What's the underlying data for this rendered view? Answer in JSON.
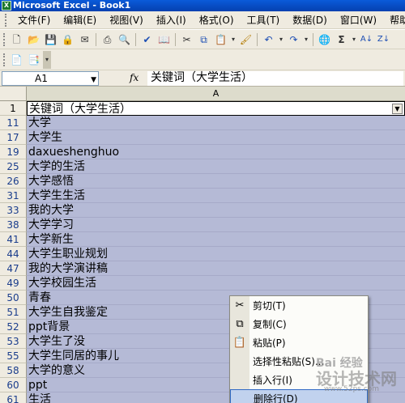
{
  "window": {
    "title": "Microsoft Excel - Book1"
  },
  "menu": [
    "文件(F)",
    "编辑(E)",
    "视图(V)",
    "插入(I)",
    "格式(O)",
    "工具(T)",
    "数据(D)",
    "窗口(W)",
    "帮助"
  ],
  "toolbar_icons": [
    "new-document-icon",
    "open-folder-icon",
    "save-icon",
    "permission-icon",
    "email-icon",
    "print-icon",
    "print-preview-icon",
    "spelling-icon",
    "research-icon",
    "cut-icon",
    "copy-icon",
    "paste-icon",
    "format-painter-icon",
    "undo-icon",
    "redo-icon",
    "hyperlink-icon",
    "autosum-icon",
    "sort-ascending-icon",
    "sort-descending-icon"
  ],
  "formula_bar": {
    "name_box": "A1",
    "fx": "fx",
    "value": "关键词（大学生活）"
  },
  "sheet": {
    "column_header": "A",
    "rows": [
      {
        "num": "1",
        "value": "关键词（大学生活）",
        "header": true
      },
      {
        "num": "11",
        "value": "大学"
      },
      {
        "num": "17",
        "value": "大学生"
      },
      {
        "num": "19",
        "value": "daxueshenghuo"
      },
      {
        "num": "25",
        "value": "大学的生活"
      },
      {
        "num": "26",
        "value": "大学感悟"
      },
      {
        "num": "31",
        "value": "大学生生活"
      },
      {
        "num": "33",
        "value": "我的大学"
      },
      {
        "num": "38",
        "value": "大学学习"
      },
      {
        "num": "41",
        "value": "大学新生"
      },
      {
        "num": "44",
        "value": "大学生职业规划"
      },
      {
        "num": "47",
        "value": "我的大学演讲稿"
      },
      {
        "num": "49",
        "value": "大学校园生活"
      },
      {
        "num": "50",
        "value": "青春"
      },
      {
        "num": "51",
        "value": "大学生自我鉴定"
      },
      {
        "num": "52",
        "value": "ppt背景"
      },
      {
        "num": "53",
        "value": "大学生了没"
      },
      {
        "num": "55",
        "value": "大学生同居的事儿"
      },
      {
        "num": "58",
        "value": "大学的意义"
      },
      {
        "num": "60",
        "value": "ppt"
      },
      {
        "num": "61",
        "value": "生活"
      }
    ]
  },
  "context_menu": {
    "items": [
      {
        "label": "剪切(T)",
        "icon": "scissors-icon",
        "glyph": "✂"
      },
      {
        "label": "复制(C)",
        "icon": "copy-icon",
        "glyph": "⧉"
      },
      {
        "label": "粘贴(P)",
        "icon": "paste-icon",
        "glyph": "📋"
      },
      {
        "label": "选择性粘贴(S)...",
        "icon": "",
        "glyph": ""
      },
      {
        "label": "插入行(I)",
        "icon": "",
        "glyph": ""
      },
      {
        "label": "删除行(D)",
        "icon": "",
        "glyph": ""
      }
    ]
  },
  "watermark": {
    "top": "Bai 经验",
    "main": "设计技术网",
    "url": "www.52ps.com"
  },
  "colors": {
    "selection": "#b5bad6",
    "title_bar": "#0a5bd9",
    "chrome": "#efebe0"
  }
}
